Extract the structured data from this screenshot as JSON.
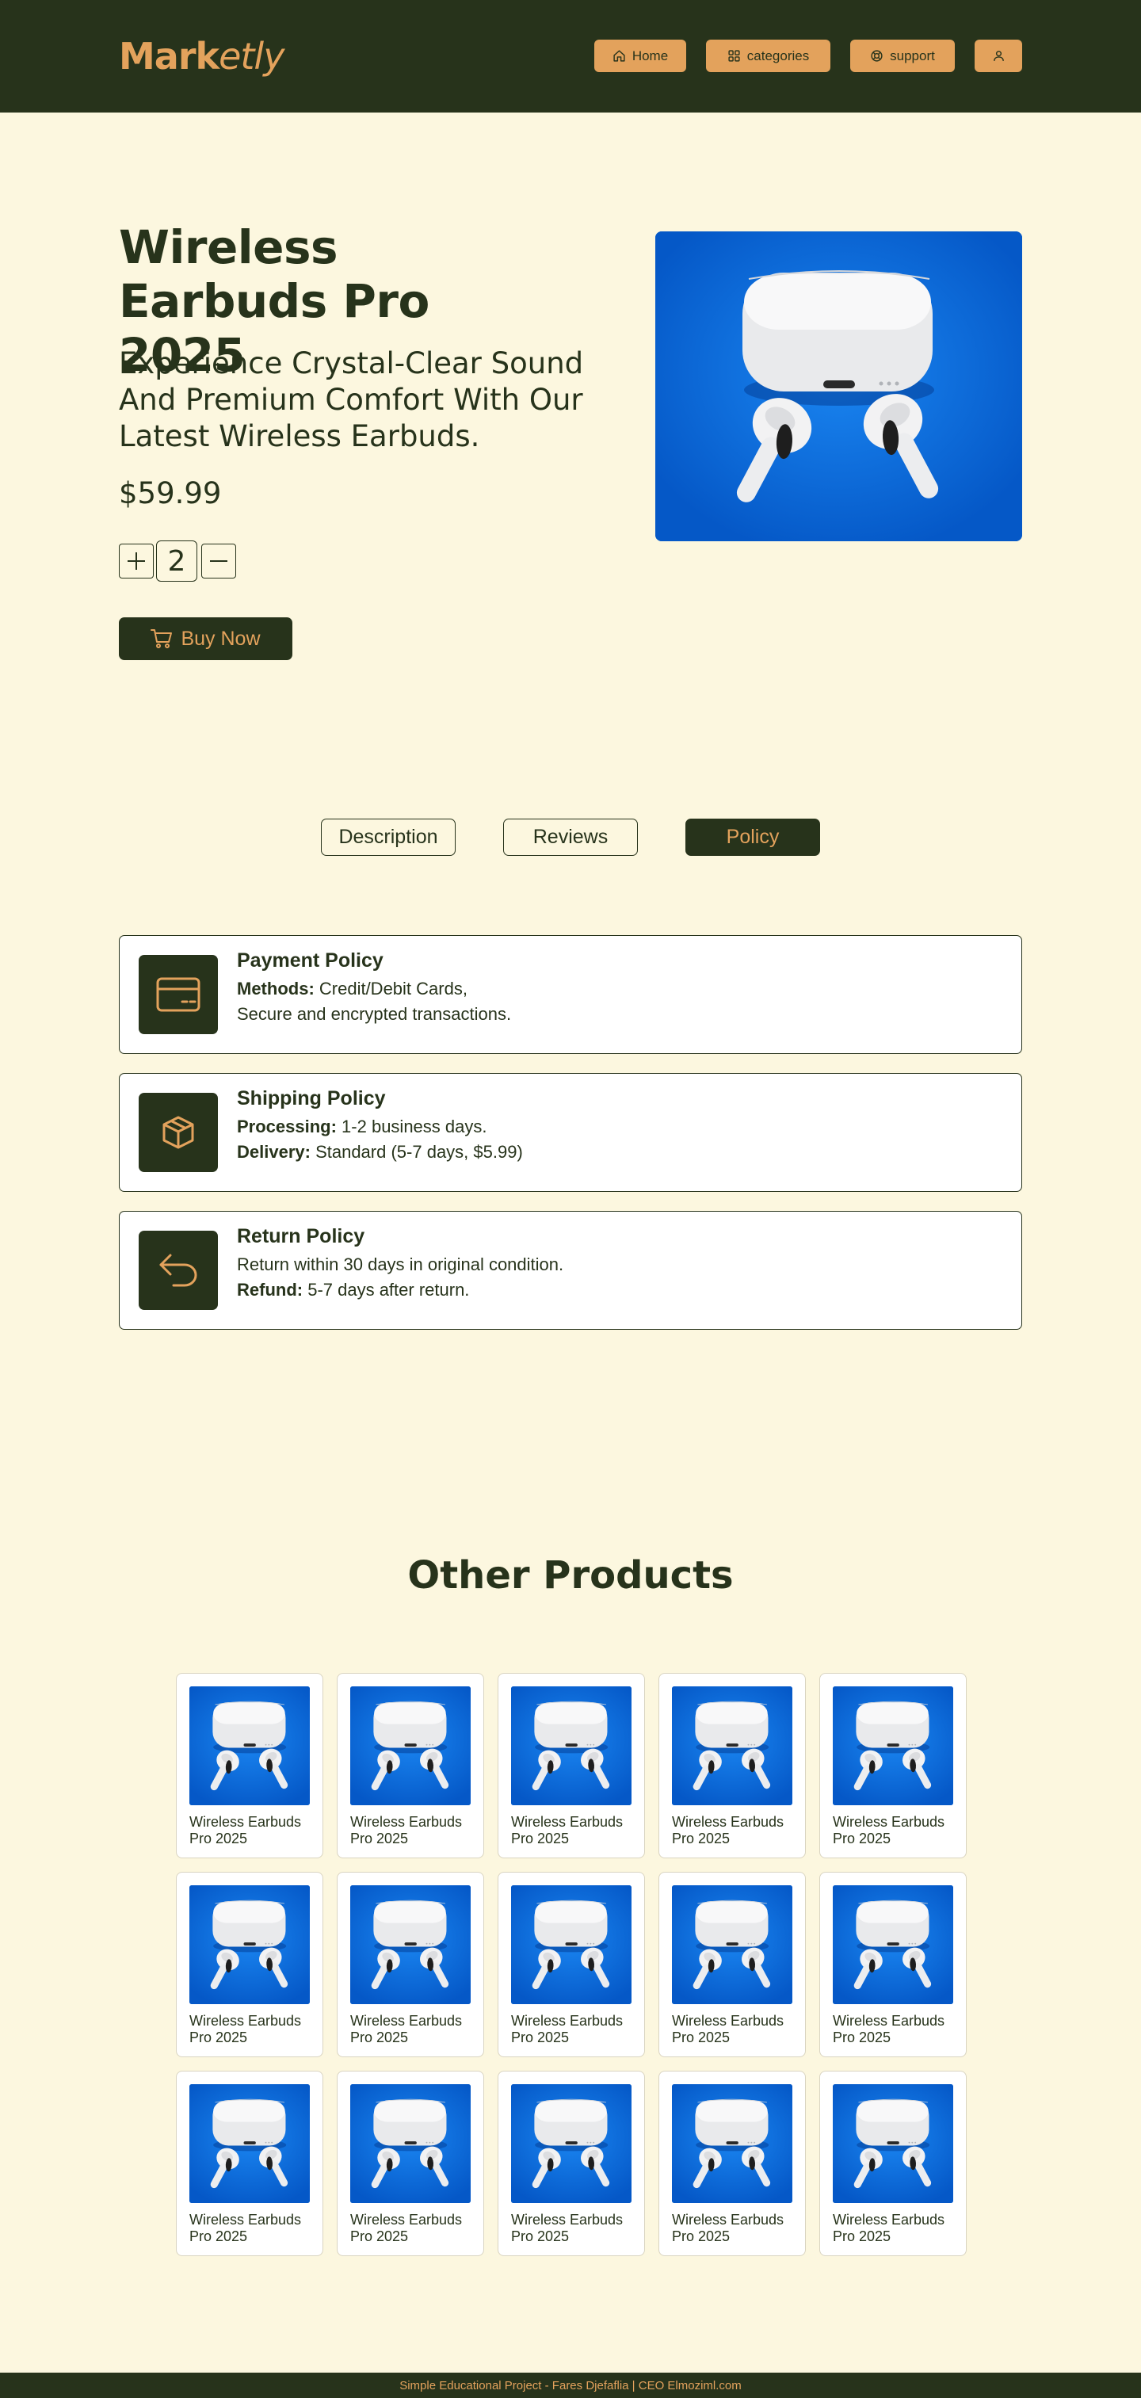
{
  "header": {
    "logo_bold": "Mark",
    "logo_italic": "etly",
    "nav": {
      "home": "Home",
      "categories": "categories",
      "support": "support"
    }
  },
  "product": {
    "title": "Wireless Earbuds Pro 2025",
    "subtitle": "Experience Crystal-Clear Sound And Premium Comfort With Our Latest Wireless Earbuds.",
    "price": "$59.99",
    "quantity": "2",
    "buy_label": "Buy Now",
    "image_colors": {
      "background": "#0a6fe0",
      "earbuds": "#f1f1f1"
    }
  },
  "tabs": {
    "description": "Description",
    "reviews": "Reviews",
    "policy": "Policy",
    "active": "policy"
  },
  "policies": {
    "payment": {
      "title": "Payment Policy",
      "l1_bold": "Methods:",
      "l1_text": " Credit/Debit Cards,",
      "l2_text": "Secure and encrypted transactions."
    },
    "shipping": {
      "title": "Shipping Policy",
      "l1_bold": "Processing:",
      "l1_text": " 1-2 business days.",
      "l2_bold": "Delivery:",
      "l2_text": " Standard (5-7 days, $5.99)"
    },
    "return": {
      "title": "Return Policy",
      "l1_text": "Return within 30 days in original condition.",
      "l2_bold": "Refund:",
      "l2_text": " 5-7 days after return."
    }
  },
  "other_products": {
    "title": "Other Products",
    "items": [
      "Wireless Earbuds Pro 2025",
      "Wireless Earbuds Pro 2025",
      "Wireless Earbuds Pro 2025",
      "Wireless Earbuds Pro 2025",
      "Wireless Earbuds Pro 2025",
      "Wireless Earbuds Pro 2025",
      "Wireless Earbuds Pro 2025",
      "Wireless Earbuds Pro 2025",
      "Wireless Earbuds Pro 2025",
      "Wireless Earbuds Pro 2025",
      "Wireless Earbuds Pro 2025",
      "Wireless Earbuds Pro 2025",
      "Wireless Earbuds Pro 2025",
      "Wireless Earbuds Pro 2025",
      "Wireless Earbuds Pro 2025"
    ]
  },
  "footer": {
    "text": "Simple Educational Project - Fares Djefaflia | CEO Elmoziml.com"
  },
  "colors": {
    "background": "#fcf7df",
    "primary_dark": "#27331b",
    "accent": "#e3a25c"
  }
}
